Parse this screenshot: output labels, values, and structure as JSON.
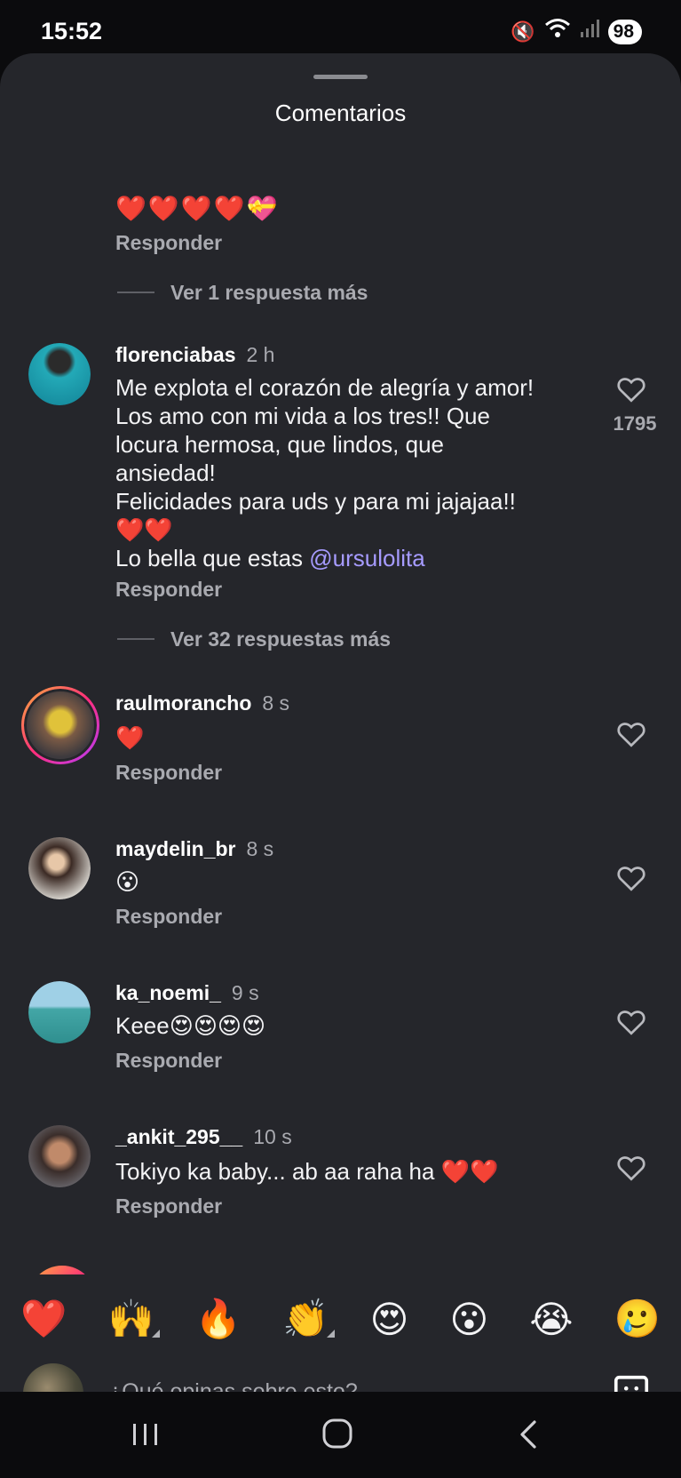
{
  "status": {
    "time": "15:52",
    "battery": "98"
  },
  "sheet": {
    "title": "Comentarios"
  },
  "partial_comment": {
    "emojis": "❤️❤️❤️❤️💝",
    "reply": "Responder",
    "more_replies": "Ver 1 respuesta más"
  },
  "comments": [
    {
      "username": "florenciabas",
      "time": "2 h",
      "lines": [
        "Me explota el corazón de alegría y amor!",
        "Los amo con mi vida a los tres!! Que",
        "locura hermosa, que lindos, que",
        "ansiedad!",
        "Felicidades para uds y para mi jajajaa!!",
        "❤️❤️"
      ],
      "last_line_prefix": "Lo bella que estas ",
      "mention": "@ursulolita",
      "likes": "1795",
      "reply": "Responder",
      "more_replies": "Ver 32 respuestas más"
    },
    {
      "username": "raulmorancho",
      "time": "8 s",
      "text": "❤️",
      "reply": "Responder"
    },
    {
      "username": "maydelin_br",
      "time": "8 s",
      "text": "😮",
      "reply": "Responder"
    },
    {
      "username": "ka_noemi_",
      "time": "9 s",
      "text": "Keee😍😍😍😍",
      "reply": "Responder"
    },
    {
      "username": "_ankit_295__",
      "time": "10 s",
      "text": "Tokiyo ka baby... ab aa raha ha ❤️❤️",
      "reply": "Responder"
    }
  ],
  "reactions": [
    "❤️",
    "🙌",
    "🔥",
    "👏",
    "😍",
    "😮",
    "😭",
    "🥲"
  ],
  "input": {
    "placeholder": "¿Qué opinas sobre esto?"
  },
  "icons": [
    "mute-icon",
    "wifi-icon",
    "signal-icon",
    "battery-icon",
    "heart-outline-icon",
    "sticker-icon",
    "recents-icon",
    "home-icon",
    "back-icon"
  ]
}
